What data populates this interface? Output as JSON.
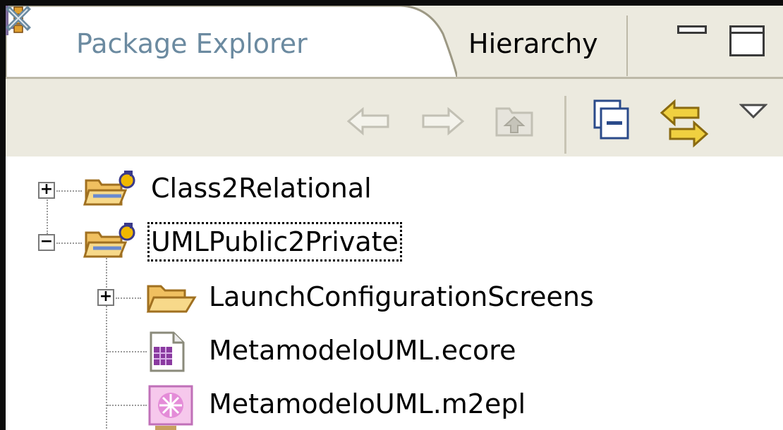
{
  "tabs": {
    "active_label": "Package Explorer",
    "other_label": "Hierarchy"
  },
  "tree": {
    "items": [
      {
        "label": "Class2Relational",
        "icon": "java-project-icon",
        "expander": "+"
      },
      {
        "label": "UMLPublic2Private",
        "icon": "java-project-icon",
        "expander": "−"
      },
      {
        "label": "LaunchConfigurationScreens",
        "icon": "folder-icon",
        "expander": "+"
      },
      {
        "label": "MetamodeloUML.ecore",
        "icon": "ecore-file-icon",
        "expander": ""
      },
      {
        "label": "MetamodeloUML.m2epl",
        "icon": "m2epl-file-icon",
        "expander": ""
      }
    ]
  },
  "colors": {
    "panel_bg": "#eceadf",
    "tab_label_inactive": "#6b8aa0",
    "folder": "#f0c060"
  }
}
